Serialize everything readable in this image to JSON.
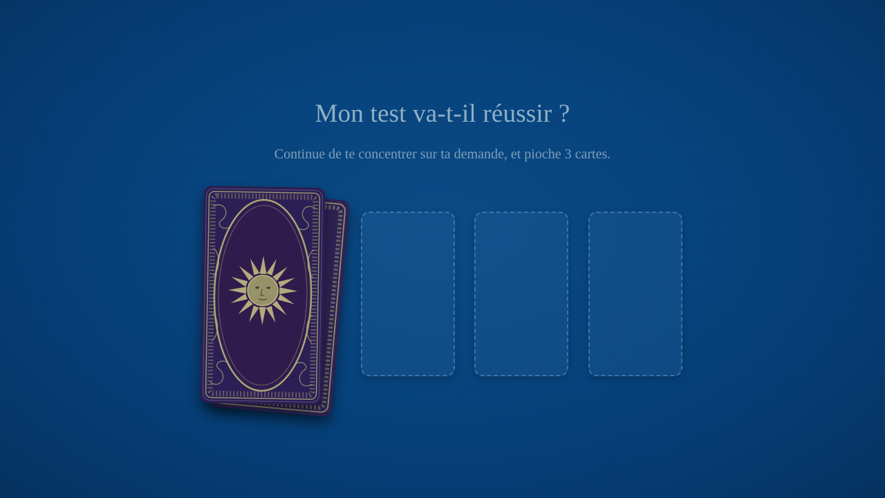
{
  "page": {
    "title": "Mon test va-t-il réussir ?",
    "instruction": "Continue de te concentrer sur ta demande, et pioche 3 cartes."
  },
  "deck": {
    "card_back_icon": "sun-face-icon",
    "card_back_color": "#2a1f52",
    "ornament_color": "#b8b27a"
  },
  "slots": [
    {
      "id": "slot-1",
      "state": "empty"
    },
    {
      "id": "slot-2",
      "state": "empty"
    },
    {
      "id": "slot-3",
      "state": "empty"
    }
  ],
  "colors": {
    "background": "#06427c",
    "title_text": "#8fb0c6",
    "slot_border": "#6f9cc2"
  }
}
